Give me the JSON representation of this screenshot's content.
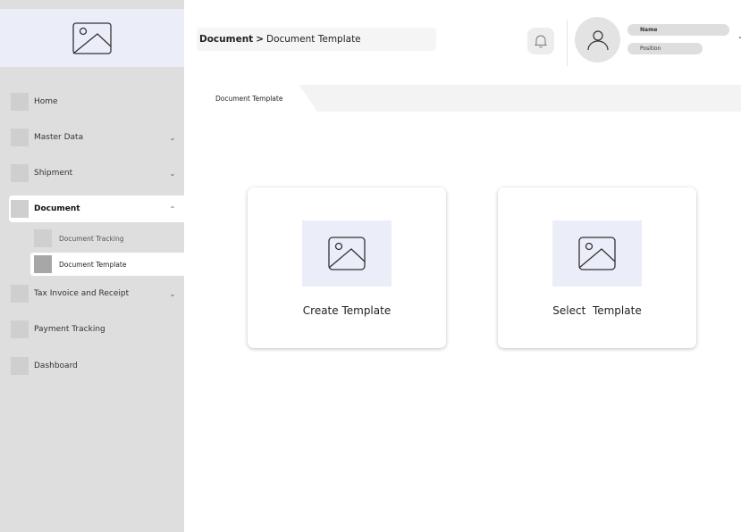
{
  "sidebar": {
    "logo_icon": "image-placeholder-icon",
    "items": [
      {
        "label": "Home",
        "chevron": ""
      },
      {
        "label": "Master Data",
        "chevron": "⌄"
      },
      {
        "label": "Shipment",
        "chevron": "⌄"
      },
      {
        "label": "Document",
        "chevron": "⌃"
      },
      {
        "label": "Tax Invoice and Receipt",
        "chevron": "⌄"
      },
      {
        "label": "Payment Tracking",
        "chevron": ""
      },
      {
        "label": "Dashboard",
        "chevron": ""
      }
    ],
    "sub_items": [
      {
        "label": "Document Tracking"
      },
      {
        "label": "Document Template"
      }
    ]
  },
  "header": {
    "breadcrumb_parent": "Document",
    "breadcrumb_sep": ">",
    "breadcrumb_current": "Document Template",
    "bell_icon": "bell-icon",
    "user_name": "Name",
    "user_position": "Position",
    "caret": "⌄"
  },
  "tabs": [
    {
      "label": "Document Template"
    }
  ],
  "cards": [
    {
      "title": "Create Template",
      "icon": "image-placeholder-icon"
    },
    {
      "title": "Select  Template",
      "icon": "image-placeholder-icon"
    }
  ]
}
